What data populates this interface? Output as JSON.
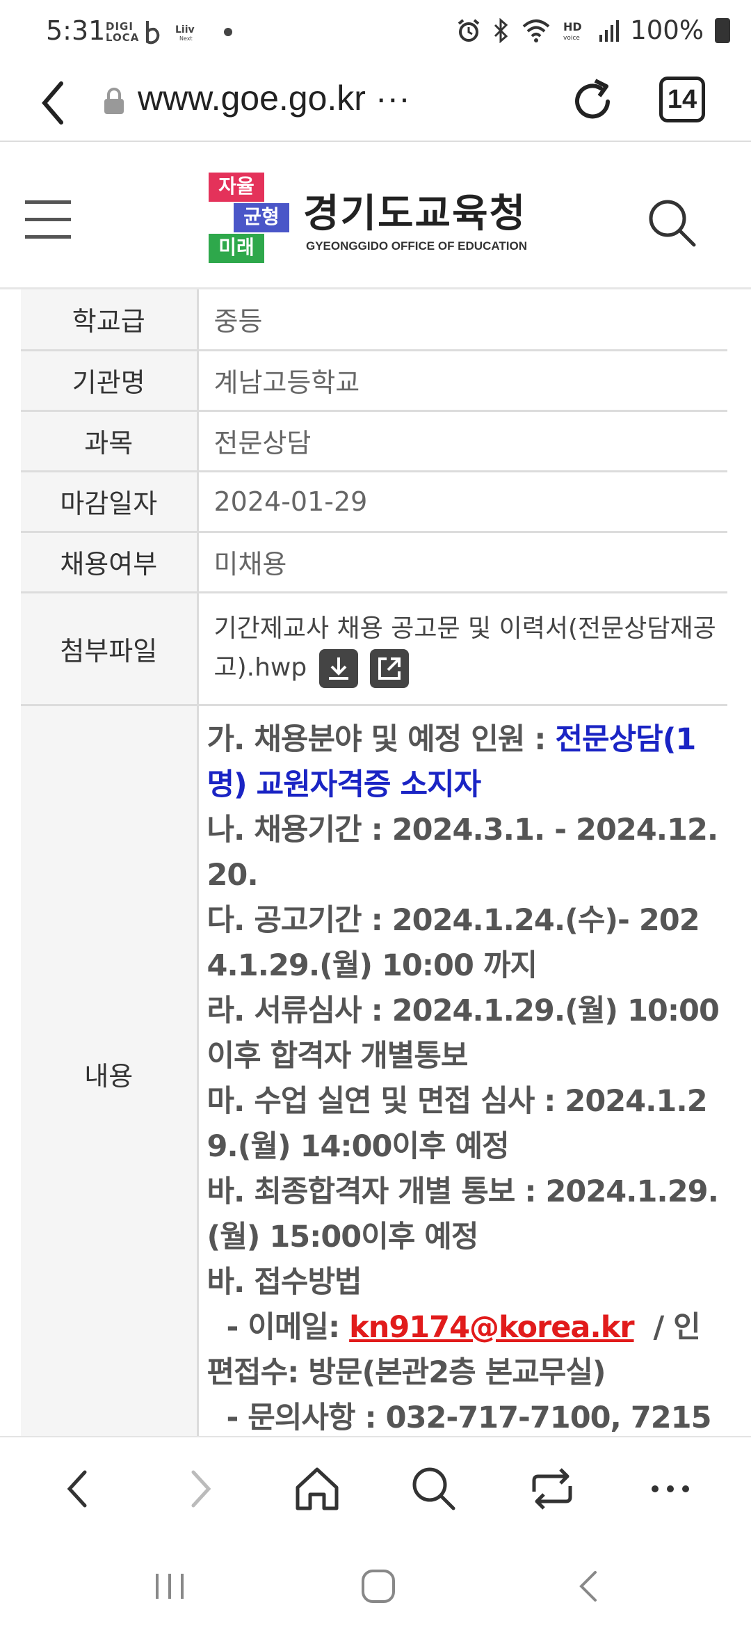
{
  "status_bar": {
    "time": "5:31",
    "digi_label": "DIGI LOCA",
    "battery": "100%",
    "icons": [
      "digi-loca-icon",
      "b-app-icon",
      "liiv-next-icon",
      "notification-dot",
      "alarm-icon",
      "bluetooth-icon",
      "wifi-icon",
      "hd-voice-icon",
      "signal-icon",
      "battery-icon"
    ]
  },
  "browser": {
    "url": "www.goe.go.kr ···",
    "tab_count": "14"
  },
  "header": {
    "logo_blocks": [
      "자율",
      "균형",
      "미래"
    ],
    "logo_title": "경기도교육청",
    "logo_subtitle": "GYEONGGIDO OFFICE OF EDUCATION"
  },
  "table": {
    "rows": [
      {
        "label": "학교급",
        "value": "중등"
      },
      {
        "label": "기관명",
        "value": "계남고등학교"
      },
      {
        "label": "과목",
        "value": "전문상담"
      },
      {
        "label": "마감일자",
        "value": "2024-01-29"
      },
      {
        "label": "채용여부",
        "value": "미채용"
      }
    ],
    "attachment": {
      "label": "첨부파일",
      "filename": "기간제교사 채용 공고문 및 이력서(전문상담재공고).hwp"
    },
    "content": {
      "label": "내용",
      "line_a_prefix": "가. 채용분야 및 예정 인원 : ",
      "line_a_highlight": "전문상담(1명) 교원자격증 소지자",
      "line_b": "나. 채용기간 : 2024.3.1. - 2024.12.20.",
      "line_c": "다. 공고기간 : 2024.1.24.(수)- 2024.1.29.(월) 10:00 까지",
      "line_d": "라. 서류심사 : 2024.1.29.(월) 10:00이후 합격자 개별통보",
      "line_e": "마. 수업 실연 및 면접 심사 : 2024.1.29.(월) 14:00이후 예정",
      "line_f": "바. 최종합격자 개별 통보 : 2024.1.29.(월) 15:00이후 예정",
      "line_g": "바. 접수방법",
      "email_prefix": "  - 이메일: ",
      "email": "kn9174@korea.kr",
      "email_suffix": "  / 인편접수: 방문(본관2층 본교무실)",
      "inquiry": "  - 문의사항 : 032-717-7100, 7215"
    }
  },
  "colors": {
    "blue_highlight": "#1a24c4",
    "red_link": "#e11b1b",
    "logo_red": "#e4325a",
    "logo_blue": "#4a56c8",
    "logo_green": "#2ea84b"
  }
}
